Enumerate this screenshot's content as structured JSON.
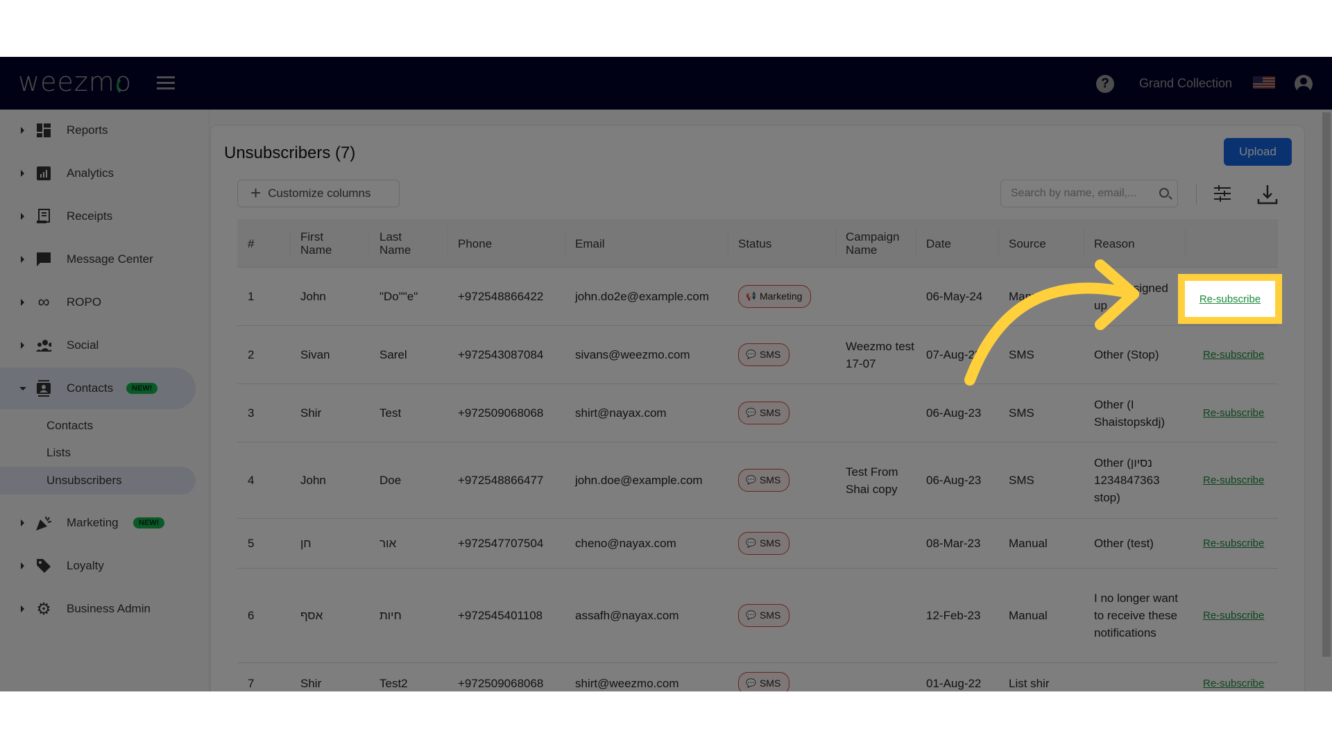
{
  "header": {
    "logo": "weezmo",
    "account_name": "Grand Collection",
    "icons": [
      "menu-icon",
      "help-icon",
      "us-flag-icon",
      "user-account-icon"
    ]
  },
  "sidebar": {
    "items": [
      {
        "label": "Reports",
        "icon": "dashboard-icon"
      },
      {
        "label": "Analytics",
        "icon": "analytics-icon"
      },
      {
        "label": "Receipts",
        "icon": "receipt-icon"
      },
      {
        "label": "Message Center",
        "icon": "chat-icon"
      },
      {
        "label": "ROPO",
        "icon": "infinity-icon"
      },
      {
        "label": "Social",
        "icon": "people-icon"
      },
      {
        "label": "Contacts",
        "icon": "contacts-icon",
        "badge": "NEW!",
        "expanded": true
      },
      {
        "label": "Marketing",
        "icon": "party-icon",
        "badge": "NEW!"
      },
      {
        "label": "Loyalty",
        "icon": "tag-icon"
      },
      {
        "label": "Business Admin",
        "icon": "gear-icon"
      }
    ],
    "contacts_sub": [
      {
        "label": "Contacts"
      },
      {
        "label": "Lists"
      },
      {
        "label": "Unsubscribers",
        "active": true
      }
    ]
  },
  "main": {
    "title": "Unsubscribers (7)",
    "upload_label": "Upload",
    "customize_label": "Customize columns",
    "search_placeholder": "Search by name, email,...",
    "columns": [
      "#",
      "First Name",
      "Last Name",
      "Phone",
      "Email",
      "Status",
      "Campaign Name",
      "Date",
      "Source",
      "Reason",
      ""
    ],
    "rows": [
      {
        "num": "1",
        "first": "John",
        "last": "\"Do\"\"e\"",
        "phone": "+972548866422",
        "email": "john.do2e@example.com",
        "status": "Marketing",
        "status_icon": "megaphone-icon",
        "campaign": "",
        "date": "06-May-24",
        "source": "Manual",
        "reason": "I never signed up",
        "action": "Re-subscribe"
      },
      {
        "num": "2",
        "first": "Sivan",
        "last": "Sarel",
        "phone": "+972543087084",
        "email": "sivans@weezmo.com",
        "status": "SMS",
        "status_icon": "chat-bubbles-icon",
        "campaign": "Weezmo test 17-07",
        "date": "07-Aug-23",
        "source": "SMS",
        "reason": "Other (Stop)",
        "action": "Re-subscribe"
      },
      {
        "num": "3",
        "first": "Shir",
        "last": "Test",
        "phone": "+972509068068",
        "email": "shirt@nayax.com",
        "status": "SMS",
        "status_icon": "chat-bubbles-icon",
        "campaign": "",
        "date": "06-Aug-23",
        "source": "SMS",
        "reason": "Other (I Shaistopskdj)",
        "action": "Re-subscribe"
      },
      {
        "num": "4",
        "first": "John",
        "last": "Doe",
        "phone": "+972548866477",
        "email": "john.doe@example.com",
        "status": "SMS",
        "status_icon": "chat-bubbles-icon",
        "campaign": "Test From Shai copy",
        "date": "06-Aug-23",
        "source": "SMS",
        "reason": "Other (נסיון 1234847363 stop)",
        "action": "Re-subscribe"
      },
      {
        "num": "5",
        "first": "חן",
        "last": "אור",
        "phone": "+972547707504",
        "email": "cheno@nayax.com",
        "status": "SMS",
        "status_icon": "chat-bubbles-icon",
        "campaign": "",
        "date": "08-Mar-23",
        "source": "Manual",
        "reason": "Other (test)",
        "action": "Re-subscribe"
      },
      {
        "num": "6",
        "first": "אסף",
        "last": "חיות",
        "phone": "+972545401108",
        "email": "assafh@nayax.com",
        "status": "SMS",
        "status_icon": "chat-bubbles-icon",
        "campaign": "",
        "date": "12-Feb-23",
        "source": "Manual",
        "reason": "I no longer want to receive these notifications",
        "action": "Re-subscribe"
      },
      {
        "num": "7",
        "first": "Shir",
        "last": "Test2",
        "phone": "+972509068068",
        "email": "shirt@weezmo.com",
        "status": "SMS",
        "status_icon": "chat-bubbles-icon",
        "campaign": "",
        "date": "01-Aug-22",
        "source": "List shir",
        "reason": "",
        "action": "Re-subscribe"
      }
    ]
  },
  "annotation": {
    "highlight_target": "Re-subscribe",
    "accent_color": "#ffd03c"
  },
  "colors": {
    "topbar": "#010228",
    "upload_button": "#1565e0",
    "new_badge": "#12b54c",
    "resubscribe_link": "#1b8a3a",
    "status_chip_border": "#d24a3a"
  }
}
